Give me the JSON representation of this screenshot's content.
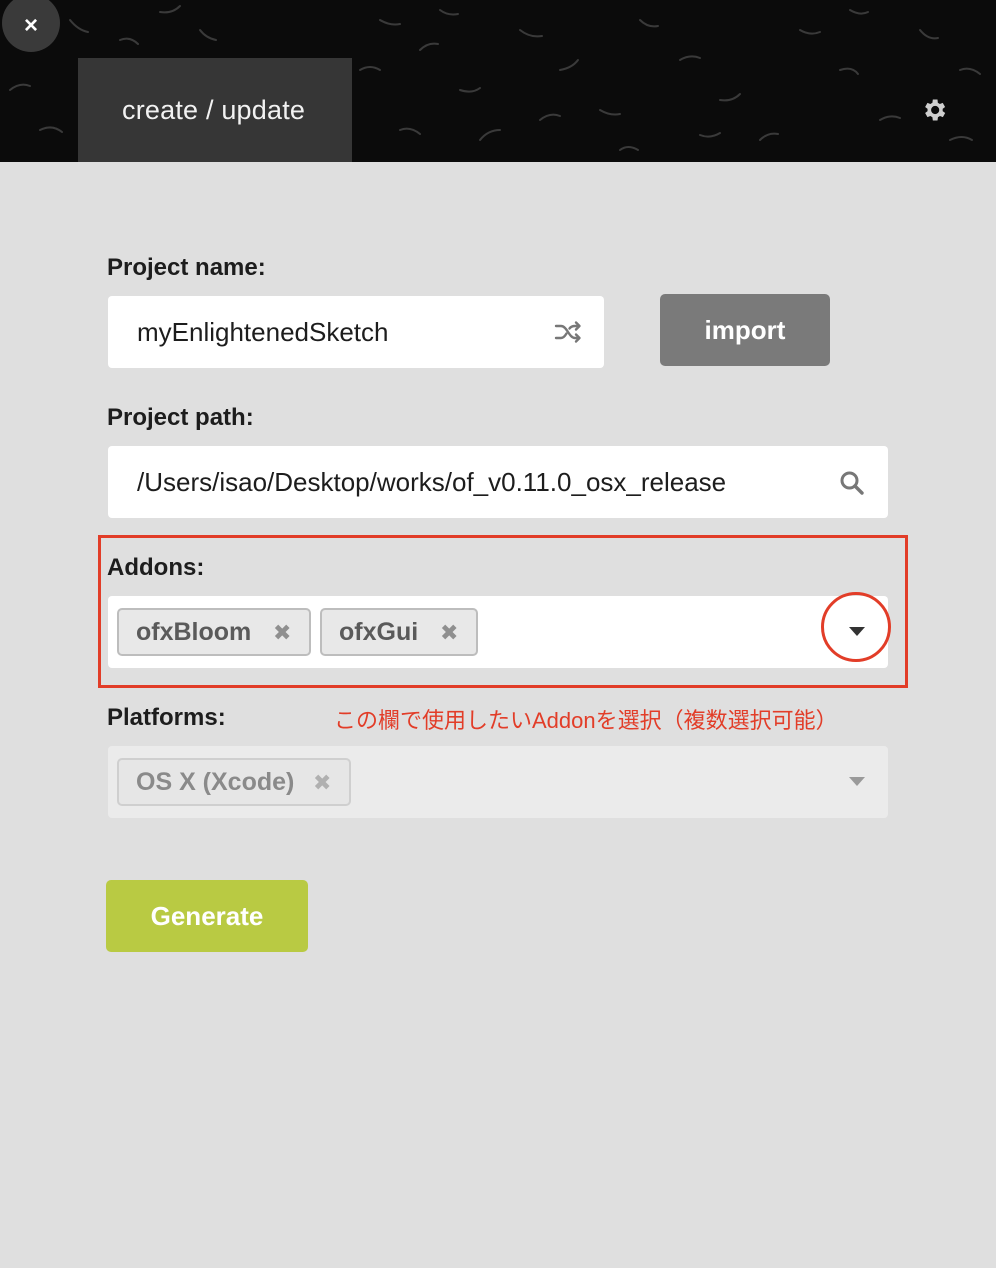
{
  "header": {
    "tab_label": "create / update",
    "close_label": "×"
  },
  "form": {
    "project_name": {
      "label": "Project name:",
      "value": "myEnlightenedSketch"
    },
    "import_label": "import",
    "project_path": {
      "label": "Project path:",
      "value": "/Users/isao/Desktop/works/of_v0.11.0_osx_release"
    },
    "addons": {
      "label": "Addons:",
      "tags": [
        "ofxBloom",
        "ofxGui"
      ]
    },
    "platforms": {
      "label": "Platforms:",
      "tags": [
        "OS X (Xcode)"
      ]
    },
    "generate_label": "Generate"
  },
  "annotation": {
    "text": "この欄で使用したいAddonを選択（複数選択可能）",
    "color": "#e23d28"
  },
  "colors": {
    "generate": "#b9ca43",
    "import": "#7a7a7a",
    "background": "#dfdfdf",
    "header": "#0b0b0b"
  }
}
